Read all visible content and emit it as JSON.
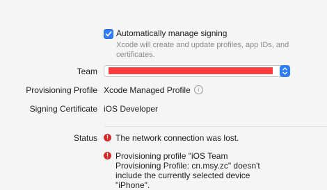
{
  "signing": {
    "auto_manage_label": "Automatically manage signing",
    "auto_manage_checked": true,
    "auto_manage_help": "Xcode will create and update profiles, app IDs, and certificates."
  },
  "fields": {
    "team_label": "Team",
    "provisioning_label": "Provisioning Profile",
    "provisioning_value": "Xcode Managed Profile",
    "certificate_label": "Signing Certificate",
    "certificate_value": "iOS Developer",
    "status_label": "Status"
  },
  "status": {
    "errors": [
      "The network connection was lost.",
      "Provisioning profile \"iOS Team Provisioning Profile: cn.msy.zc\" doesn't include the currently selected device \"iPhone\"."
    ]
  },
  "icons": {
    "checkbox": "checkmark-icon",
    "info": "info-icon",
    "error": "error-icon",
    "stepper": "chevron-up-down-icon"
  },
  "colors": {
    "accent": "#2f7df6",
    "error": "#d62b2b",
    "redaction": "#ff3b3b"
  }
}
